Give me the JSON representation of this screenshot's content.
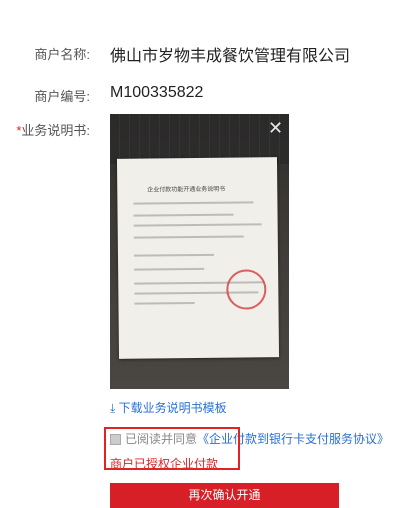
{
  "merchant": {
    "name_label": "商户名称:",
    "name_value": "佛山市岁物丰成餐饮管理有限公司",
    "id_label": "商户编号:",
    "id_value": "M100335822"
  },
  "business_doc": {
    "required_mark": "*",
    "label": "业务说明书:",
    "doc_title": "企业付款功能开通业务说明书"
  },
  "actions": {
    "download_label": "下载业务说明书模板",
    "agree_text": "已阅读并同意",
    "agree_protocol": "《企业付款到银行卡支付服务协议》",
    "authorized_text": "商户已授权企业付款",
    "confirm_button": "再次确认开通"
  },
  "colors": {
    "accent_red": "#d61f26",
    "link_blue": "#2a6fd6"
  },
  "icons": {
    "close": "close-icon",
    "download": "download-icon",
    "checkbox": "checkbox-icon"
  }
}
